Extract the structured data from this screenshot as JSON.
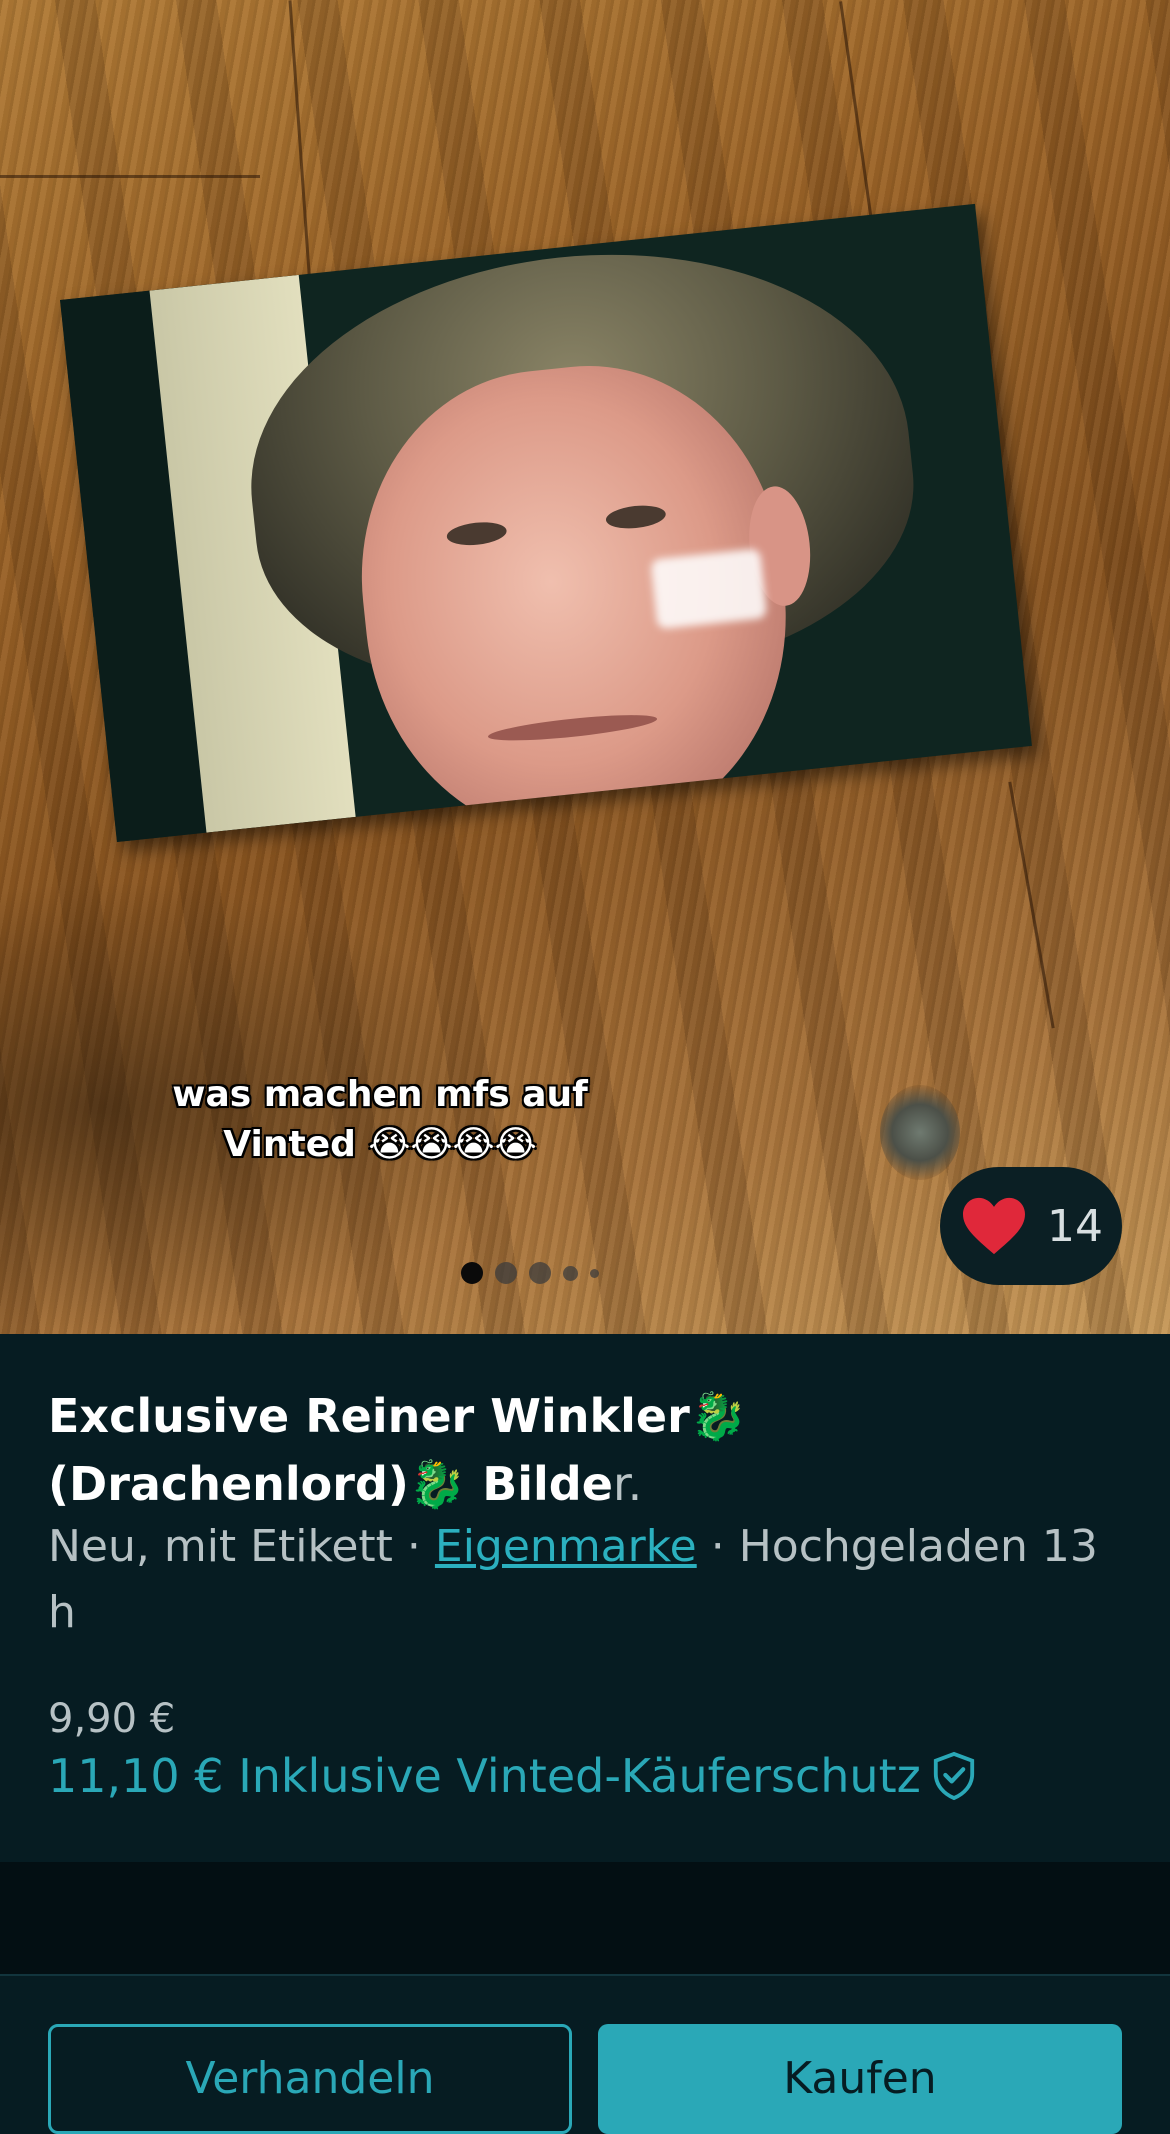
{
  "photo": {
    "overlay_text_line1": "was machen mfs auf",
    "overlay_text_line2": "Vinted 😭😭😭😭",
    "like_count": "14",
    "image_index": 1,
    "image_count": 5
  },
  "listing": {
    "title_part1": "Exclusive Reiner Winkler",
    "title_dragon": "🐉",
    "title_part2": " (Drachenlord)",
    "title_part3": "Bilde",
    "title_fade": "r.",
    "condition": "Neu, mit Etikett",
    "separator": " · ",
    "brand": "Eigenmarke",
    "uploaded": "Hochgeladen 13 h",
    "price": "9,90 €",
    "price_total": "11,10 € Inklusive Vinted-Käuferschutz"
  },
  "actions": {
    "offer_label": "Verhandeln",
    "buy_label": "Kaufen"
  },
  "colors": {
    "accent": "#2aa8b7",
    "background": "#061c22",
    "heart": "#e0283a"
  }
}
